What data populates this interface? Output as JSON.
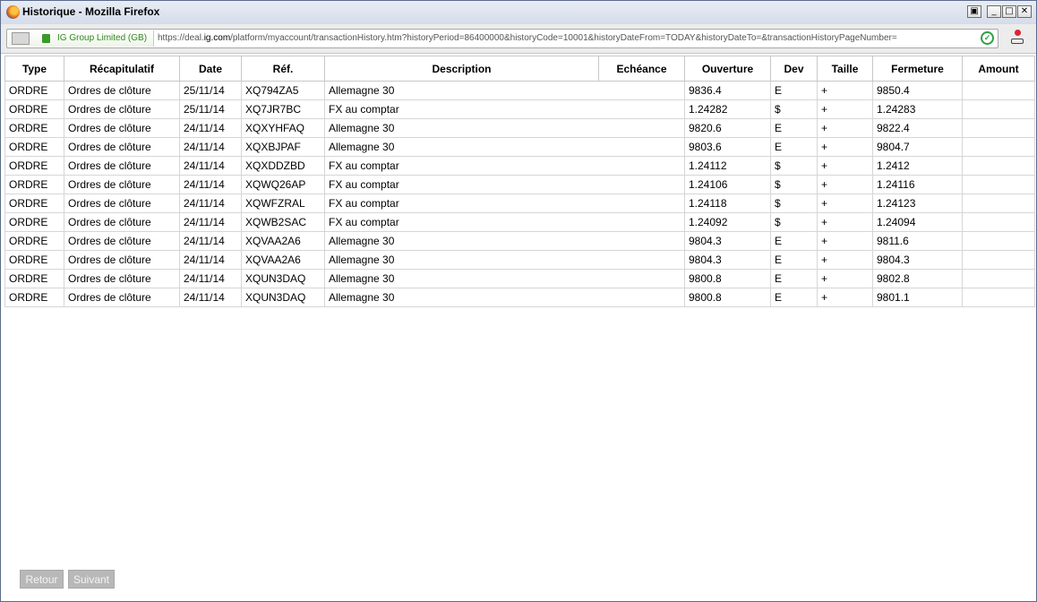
{
  "window": {
    "title": "Historique - Mozilla Firefox"
  },
  "addressbar": {
    "identity": "IG Group Limited (GB)",
    "url_prefix": "https://deal.",
    "url_domain": "ig.com",
    "url_rest": "/platform/myaccount/transactionHistory.htm?historyPeriod=86400000&historyCode=10001&historyDateFrom=TODAY&historyDateTo=&transactionHistoryPageNumber="
  },
  "table": {
    "headers": [
      "Type",
      "Récapitulatif",
      "Date",
      "Réf.",
      "Description",
      "Echéance",
      "Ouverture",
      "Dev",
      "Taille",
      "Fermeture",
      "Amount"
    ],
    "rows": [
      {
        "type": "ORDRE",
        "recap": "Ordres de clôture",
        "date": "25/11/14",
        "ref": "XQ794ZA5",
        "desc": "Allemagne 30",
        "ech": "",
        "ouv": "9836.4",
        "dev": "E",
        "taille": "+",
        "ferm": "9850.4",
        "amount": ""
      },
      {
        "type": "ORDRE",
        "recap": "Ordres de clôture",
        "date": "25/11/14",
        "ref": "XQ7JR7BC",
        "desc": "FX au comptar",
        "ech": "",
        "ouv": "1.24282",
        "dev": "$",
        "taille": "+",
        "ferm": "1.24283",
        "amount": ""
      },
      {
        "type": "ORDRE",
        "recap": "Ordres de clôture",
        "date": "24/11/14",
        "ref": "XQXYHFAQ",
        "desc": "Allemagne 30",
        "ech": "",
        "ouv": "9820.6",
        "dev": "E",
        "taille": "+",
        "ferm": "9822.4",
        "amount": ""
      },
      {
        "type": "ORDRE",
        "recap": "Ordres de clôture",
        "date": "24/11/14",
        "ref": "XQXBJPAF",
        "desc": "Allemagne 30",
        "ech": "",
        "ouv": "9803.6",
        "dev": "E",
        "taille": "+",
        "ferm": "9804.7",
        "amount": ""
      },
      {
        "type": "ORDRE",
        "recap": "Ordres de clôture",
        "date": "24/11/14",
        "ref": "XQXDDZBD",
        "desc": "FX au comptar",
        "ech": "",
        "ouv": "1.24112",
        "dev": "$",
        "taille": "+",
        "ferm": "1.2412",
        "amount": ""
      },
      {
        "type": "ORDRE",
        "recap": "Ordres de clôture",
        "date": "24/11/14",
        "ref": "XQWQ26AP",
        "desc": "FX au comptar",
        "ech": "",
        "ouv": "1.24106",
        "dev": "$",
        "taille": "+",
        "ferm": "1.24116",
        "amount": ""
      },
      {
        "type": "ORDRE",
        "recap": "Ordres de clôture",
        "date": "24/11/14",
        "ref": "XQWFZRAL",
        "desc": "FX au comptar",
        "ech": "",
        "ouv": "1.24118",
        "dev": "$",
        "taille": "+",
        "ferm": "1.24123",
        "amount": ""
      },
      {
        "type": "ORDRE",
        "recap": "Ordres de clôture",
        "date": "24/11/14",
        "ref": "XQWB2SAC",
        "desc": "FX au comptar",
        "ech": "",
        "ouv": "1.24092",
        "dev": "$",
        "taille": "+",
        "ferm": "1.24094",
        "amount": ""
      },
      {
        "type": "ORDRE",
        "recap": "Ordres de clôture",
        "date": "24/11/14",
        "ref": "XQVAA2A6",
        "desc": "Allemagne 30",
        "ech": "",
        "ouv": "9804.3",
        "dev": "E",
        "taille": "+",
        "ferm": "9811.6",
        "amount": ""
      },
      {
        "type": "ORDRE",
        "recap": "Ordres de clôture",
        "date": "24/11/14",
        "ref": "XQVAA2A6",
        "desc": "Allemagne 30",
        "ech": "",
        "ouv": "9804.3",
        "dev": "E",
        "taille": "+",
        "ferm": "9804.3",
        "amount": ""
      },
      {
        "type": "ORDRE",
        "recap": "Ordres de clôture",
        "date": "24/11/14",
        "ref": "XQUN3DAQ",
        "desc": "Allemagne 30",
        "ech": "",
        "ouv": "9800.8",
        "dev": "E",
        "taille": "+",
        "ferm": "9802.8",
        "amount": ""
      },
      {
        "type": "ORDRE",
        "recap": "Ordres de clôture",
        "date": "24/11/14",
        "ref": "XQUN3DAQ",
        "desc": "Allemagne 30",
        "ech": "",
        "ouv": "9800.8",
        "dev": "E",
        "taille": "+",
        "ferm": "9801.1",
        "amount": ""
      }
    ]
  },
  "pagination": {
    "prev_label": "Retour",
    "next_label": "Suivant"
  },
  "colors": {
    "ssl_green": "#2f8a1e",
    "disabled_button": "#b8b8b8"
  }
}
